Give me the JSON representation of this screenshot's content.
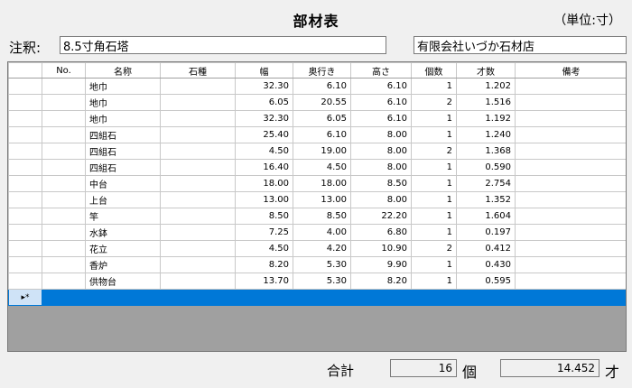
{
  "title": "部材表",
  "unit_note": "（単位:寸）",
  "note": {
    "label": "注釈:",
    "value": "8.5寸角石塔"
  },
  "company": {
    "value": "有限会社いづか石材店"
  },
  "columns": [
    "",
    "No.",
    "名称",
    "石種",
    "幅",
    "奥行き",
    "高さ",
    "個数",
    "才数",
    "備考"
  ],
  "rows": [
    {
      "no": "",
      "name": "地巾",
      "stone": "",
      "width": "32.30",
      "depth": "6.10",
      "height": "6.10",
      "count": "1",
      "sai": "1.202",
      "note": ""
    },
    {
      "no": "",
      "name": "地巾",
      "stone": "",
      "width": "6.05",
      "depth": "20.55",
      "height": "6.10",
      "count": "2",
      "sai": "1.516",
      "note": ""
    },
    {
      "no": "",
      "name": "地巾",
      "stone": "",
      "width": "32.30",
      "depth": "6.05",
      "height": "6.10",
      "count": "1",
      "sai": "1.192",
      "note": ""
    },
    {
      "no": "",
      "name": "四組石",
      "stone": "",
      "width": "25.40",
      "depth": "6.10",
      "height": "8.00",
      "count": "1",
      "sai": "1.240",
      "note": ""
    },
    {
      "no": "",
      "name": "四組石",
      "stone": "",
      "width": "4.50",
      "depth": "19.00",
      "height": "8.00",
      "count": "2",
      "sai": "1.368",
      "note": ""
    },
    {
      "no": "",
      "name": "四組石",
      "stone": "",
      "width": "16.40",
      "depth": "4.50",
      "height": "8.00",
      "count": "1",
      "sai": "0.590",
      "note": ""
    },
    {
      "no": "",
      "name": "中台",
      "stone": "",
      "width": "18.00",
      "depth": "18.00",
      "height": "8.50",
      "count": "1",
      "sai": "2.754",
      "note": ""
    },
    {
      "no": "",
      "name": "上台",
      "stone": "",
      "width": "13.00",
      "depth": "13.00",
      "height": "8.00",
      "count": "1",
      "sai": "1.352",
      "note": ""
    },
    {
      "no": "",
      "name": "竿",
      "stone": "",
      "width": "8.50",
      "depth": "8.50",
      "height": "22.20",
      "count": "1",
      "sai": "1.604",
      "note": ""
    },
    {
      "no": "",
      "name": "水鉢",
      "stone": "",
      "width": "7.25",
      "depth": "4.00",
      "height": "6.80",
      "count": "1",
      "sai": "0.197",
      "note": ""
    },
    {
      "no": "",
      "name": "花立",
      "stone": "",
      "width": "4.50",
      "depth": "4.20",
      "height": "10.90",
      "count": "2",
      "sai": "0.412",
      "note": ""
    },
    {
      "no": "",
      "name": "香炉",
      "stone": "",
      "width": "8.20",
      "depth": "5.30",
      "height": "9.90",
      "count": "1",
      "sai": "0.430",
      "note": ""
    },
    {
      "no": "",
      "name": "供物台",
      "stone": "",
      "width": "13.70",
      "depth": "5.30",
      "height": "8.20",
      "count": "1",
      "sai": "0.595",
      "note": ""
    }
  ],
  "new_row_marker": "▸*",
  "footer": {
    "total_label": "合計",
    "total_count": "16",
    "count_unit": "個",
    "total_sai": "14.452",
    "sai_unit": "才"
  }
}
